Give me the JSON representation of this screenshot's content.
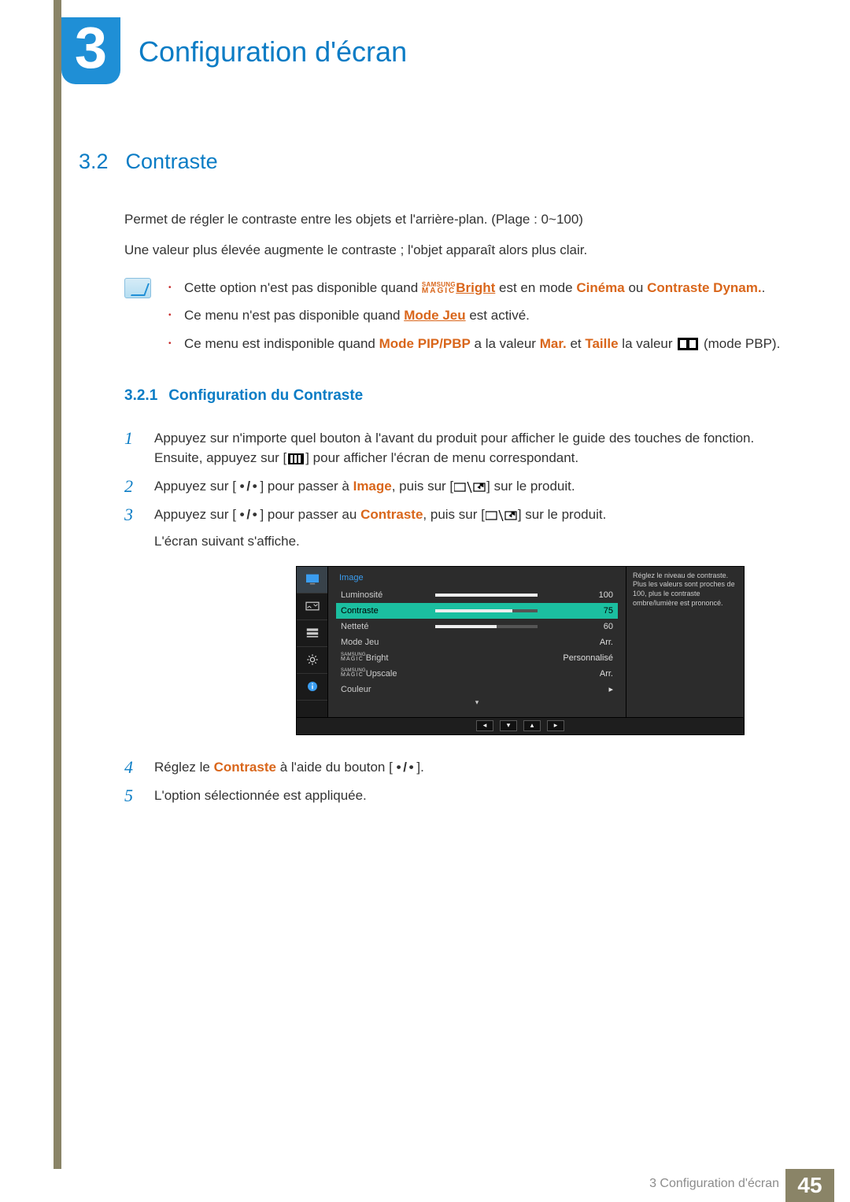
{
  "chapter": {
    "number": "3",
    "title": "Configuration d'écran"
  },
  "section": {
    "number": "3.2",
    "title": "Contraste",
    "intro1": "Permet de régler le contraste entre les objets et l'arrière-plan. (Plage : 0~100)",
    "intro2": "Une valeur plus élevée augmente le contraste ; l'objet apparaît alors plus clair."
  },
  "notes": {
    "n1_pre": "Cette option n'est pas disponible quand ",
    "magic": {
      "top": "SAMSUNG",
      "bottom": "MAGIC"
    },
    "n1_bright": "Bright",
    "n1_mid": " est en mode ",
    "n1_cinema": "Cinéma",
    "n1_or": " ou ",
    "n1_dyn": "Contraste Dynam.",
    "n1_end": ".",
    "n2_pre": "Ce menu n'est pas disponible quand ",
    "n2_mode": "Mode Jeu",
    "n2_post": " est activé.",
    "n3_pre": "Ce menu est indisponible quand ",
    "n3_mode": "Mode PIP/PBP",
    "n3_mid": " a la valeur ",
    "n3_mar": "Mar.",
    "n3_and": " et ",
    "n3_taille": "Taille",
    "n3_val": " la valeur ",
    "n3_post": " (mode PBP)."
  },
  "subsection": {
    "number": "3.2.1",
    "title": "Configuration du Contraste"
  },
  "steps": {
    "s1a": "Appuyez sur n'importe quel bouton à l'avant du produit pour afficher le guide des touches de fonction. Ensuite, appuyez sur [",
    "s1b": "] pour afficher l'écran de menu correspondant.",
    "s2a": "Appuyez sur [ ",
    "s2b": " ] pour passer à ",
    "s2_img": "Image",
    "s2c": ", puis sur [",
    "s2d": "] sur le produit.",
    "s3a": "Appuyez sur [ ",
    "s3b": " ] pour passer au ",
    "s3_con": "Contraste",
    "s3c": ", puis sur [",
    "s3d": "] sur le produit.",
    "s3e": "L'écran suivant s'affiche.",
    "s4a": "Réglez le ",
    "s4_con": "Contraste",
    "s4b": " à l'aide du bouton [ ",
    "s4c": " ].",
    "s5": "L'option sélectionnée est appliquée.",
    "dots": "• / •"
  },
  "osd": {
    "title": "Image",
    "hint": "Réglez le niveau de contraste. Plus les valeurs sont proches de 100, plus le contraste ombre/lumière est prononcé.",
    "rows": [
      {
        "label": "Luminosité",
        "value": "100",
        "bar": 100,
        "hl": false
      },
      {
        "label": "Contraste",
        "value": "75",
        "bar": 75,
        "hl": true
      },
      {
        "label": "Netteté",
        "value": "60",
        "bar": 60,
        "hl": false
      },
      {
        "label": "Mode Jeu",
        "value": "Arr.",
        "bar": null,
        "hl": false
      },
      {
        "label": "__MAGIC__Bright",
        "value": "Personnalisé",
        "bar": null,
        "hl": false
      },
      {
        "label": "__MAGIC__Upscale",
        "value": "Arr.",
        "bar": null,
        "hl": false
      },
      {
        "label": "Couleur",
        "value": "▸",
        "bar": null,
        "hl": false
      }
    ],
    "nav": [
      "◂",
      "▾",
      "▴",
      "▸"
    ],
    "caret": "▾",
    "magic": {
      "top": "SAMSUNG",
      "bottom": "MAGIC"
    }
  },
  "footer": {
    "text": "3 Configuration d'écran",
    "page": "45"
  }
}
